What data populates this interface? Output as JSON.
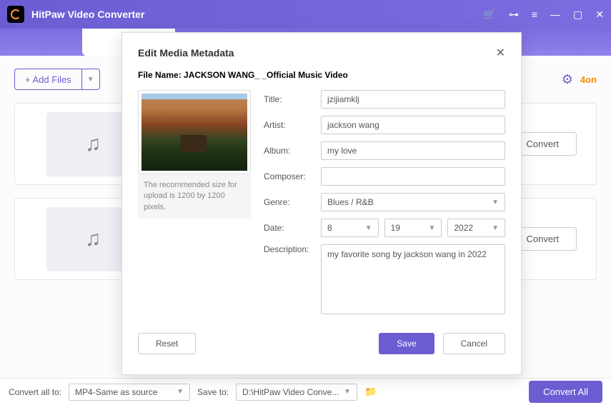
{
  "app": {
    "title": "HitPaw Video Converter"
  },
  "toolbar": {
    "add_files": "+ Add Files",
    "orange_text": "4on"
  },
  "file_items": {
    "convert_label": "Convert"
  },
  "bottombar": {
    "convert_all_to_label": "Convert all to:",
    "convert_all_to_value": "MP4-Same as source",
    "save_to_label": "Save to:",
    "save_to_value": "D:\\HitPaw Video Conve...",
    "convert_all_btn": "Convert All"
  },
  "modal": {
    "title": "Edit Media Metadata",
    "file_name_label": "File Name:",
    "file_name_value": "JACKSON WANG_ _Official Music Video",
    "thumb_hint": "The recommended size for upload is 1200 by 1200 pixels.",
    "labels": {
      "title": "Title:",
      "artist": "Artist:",
      "album": "Album:",
      "composer": "Composer:",
      "genre": "Genre:",
      "date": "Date:",
      "description": "Description:"
    },
    "values": {
      "title": "jzijiamklj",
      "artist": "jackson wang",
      "album": "my love",
      "composer": "",
      "genre": "Blues / R&B",
      "month": "8",
      "day": "19",
      "year": "2022",
      "description": "my favorite song by jackson wang in 2022"
    },
    "buttons": {
      "reset": "Reset",
      "save": "Save",
      "cancel": "Cancel"
    }
  }
}
